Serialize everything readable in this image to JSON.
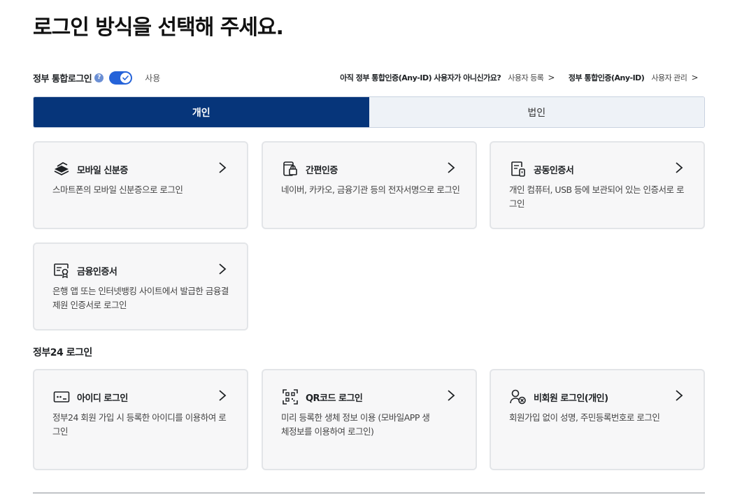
{
  "page": {
    "title": "로그인 방식을 선택해 주세요."
  },
  "gov_login": {
    "label": "정부 통합로그인",
    "help": "?",
    "toggle_on": true,
    "toggle_label": "사용",
    "question": "아직 정부 통합인증(Any-ID) 사용자가 아니신가요?",
    "register_link": "사용자 등록",
    "anyid_label": "정부 통합인증(Any-ID)",
    "manage_link": "사용자 관리",
    "chevron": ">"
  },
  "tabs": [
    {
      "label": "개인",
      "active": true
    },
    {
      "label": "법인",
      "active": false
    }
  ],
  "individual_methods": [
    {
      "icon": "mobile-id-icon",
      "title": "모바일 신분증",
      "desc": "스마트폰의 모바일 신분증으로 로그인"
    },
    {
      "icon": "simple-auth-icon",
      "title": "간편인증",
      "desc": "네이버, 카카오, 금융기관 등의 전자서명으로 로그인"
    },
    {
      "icon": "joint-certificate-icon",
      "title": "공동인증서",
      "desc": "개인 컴퓨터, USB 등에 보관되어 있는 인증서로 로그인"
    },
    {
      "icon": "financial-certificate-icon",
      "title": "금융인증서",
      "desc": "은행 앱 또는 인터넷뱅킹 사이트에서 발급한 금융결제원 인증서로 로그인"
    }
  ],
  "gov24_section": {
    "title": "정부24 로그인"
  },
  "gov24_methods": [
    {
      "icon": "id-login-icon",
      "title": "아이디 로그인",
      "desc": "정부24 회원 가입 시 등록한 아이디를 이용하여 로그인"
    },
    {
      "icon": "qr-code-icon",
      "title": "QR코드 로그인",
      "desc": "미리 등록한 생체 정보 이용 (모바일APP 생체정보를 이용하여 로그인)"
    },
    {
      "icon": "non-member-icon",
      "title": "비회원 로그인(개인)",
      "desc": "회원가입 없이 성명, 주민등록번호로 로그인"
    }
  ]
}
